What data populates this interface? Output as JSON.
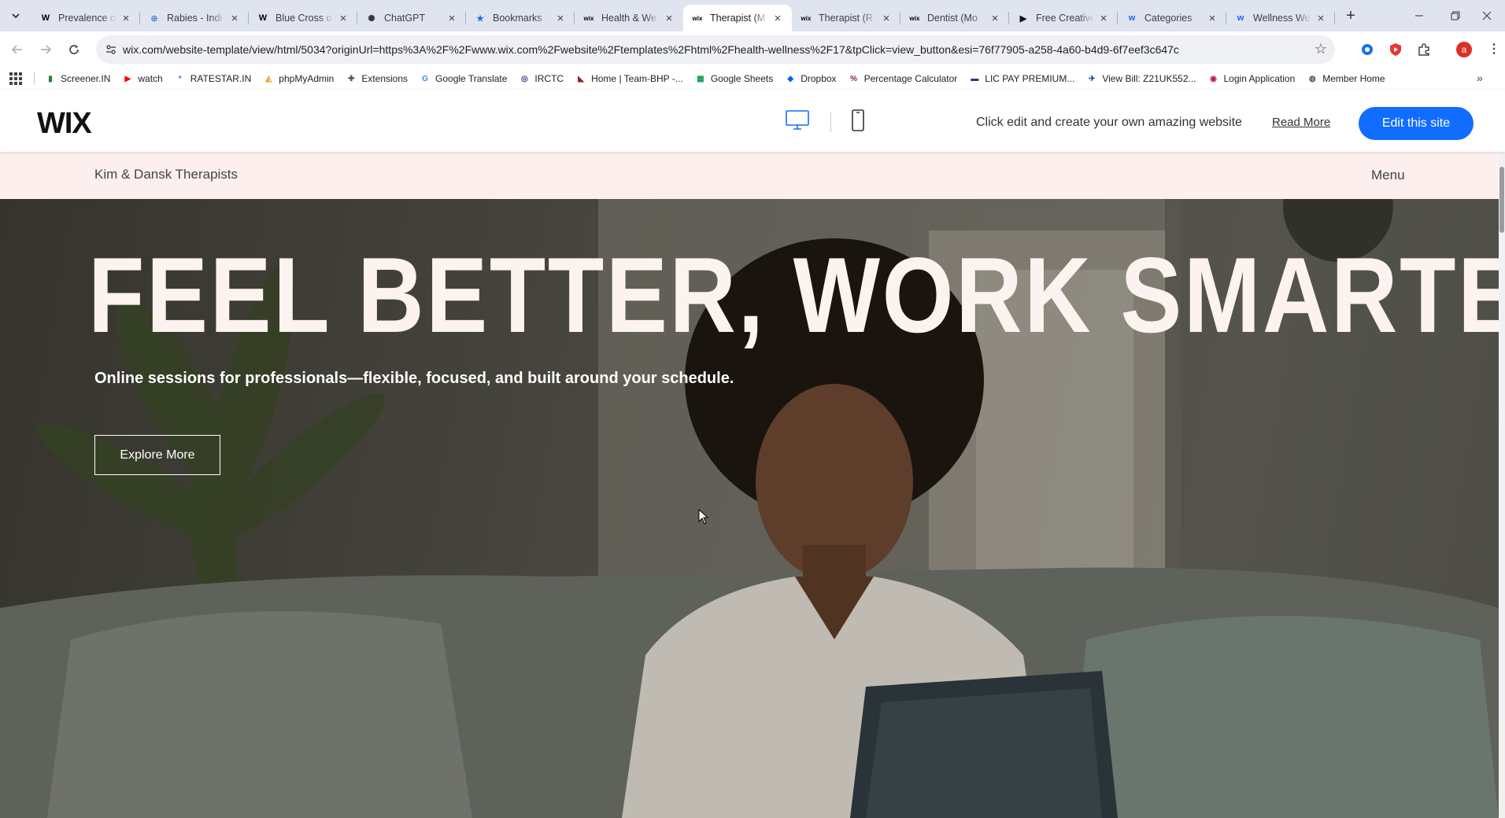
{
  "browser": {
    "tabs": [
      {
        "title": "Prevalence o",
        "favicon": "wikipedia-icon",
        "fav_text": "W",
        "fav_color": "#000000"
      },
      {
        "title": "Rabies - Indi",
        "favicon": "globe-icon",
        "fav_text": "⊕",
        "fav_color": "#5b8bd6"
      },
      {
        "title": "Blue Cross o",
        "favicon": "wikipedia-icon",
        "fav_text": "W",
        "fav_color": "#000000"
      },
      {
        "title": "ChatGPT",
        "favicon": "chatgpt-icon",
        "fav_text": "✺",
        "fav_color": "#333333"
      },
      {
        "title": "Bookmarks",
        "favicon": "star-icon",
        "fav_text": "★",
        "fav_color": "#1a73e8"
      },
      {
        "title": "Health & We",
        "favicon": "wix-icon",
        "fav_text": "wix",
        "fav_color": "#000000"
      },
      {
        "title": "Therapist (M",
        "favicon": "wix-icon",
        "fav_text": "wix",
        "fav_color": "#000000"
      },
      {
        "title": "Therapist (R",
        "favicon": "wix-icon",
        "fav_text": "wix",
        "fav_color": "#000000"
      },
      {
        "title": "Dentist (Mo",
        "favicon": "wix-icon",
        "fav_text": "wix",
        "fav_color": "#000000"
      },
      {
        "title": "Free Creative",
        "favicon": "framer-icon",
        "fav_text": "▶",
        "fav_color": "#111111"
      },
      {
        "title": "Categories",
        "favicon": "webflow-icon",
        "fav_text": "w",
        "fav_color": "#1a66ff"
      },
      {
        "title": "Wellness We",
        "favicon": "webflow-icon",
        "fav_text": "w",
        "fav_color": "#1a66ff"
      }
    ],
    "active_tab_index": 6,
    "url": "wix.com/website-template/view/html/5034?originUrl=https%3A%2F%2Fwww.wix.com%2Fwebsite%2Ftemplates%2Fhtml%2Fhealth-wellness%2F17&tpClick=view_button&esi=76f77905-a258-4a60-b4d9-6f7eef3c647c",
    "profile_initial": "a",
    "bookmarks": [
      {
        "label": "Screener.IN",
        "icon": "bar-chart-icon",
        "text": "▮",
        "color": "#2e7d32"
      },
      {
        "label": "watch",
        "icon": "youtube-icon",
        "text": "▶",
        "color": "#ff0000"
      },
      {
        "label": "RATESTAR.IN",
        "icon": "ratestar-icon",
        "text": "⁺",
        "color": "#1a73e8"
      },
      {
        "label": "phpMyAdmin",
        "icon": "phpmyadmin-icon",
        "text": "◭",
        "color": "#f29111"
      },
      {
        "label": "Extensions",
        "icon": "puzzle-icon",
        "text": "✚",
        "color": "#555555"
      },
      {
        "label": "Google Translate",
        "icon": "translate-icon",
        "text": "G",
        "color": "#4285f4"
      },
      {
        "label": "IRCTC",
        "icon": "irctc-icon",
        "text": "◎",
        "color": "#2b3f8c"
      },
      {
        "label": "Home | Team-BHP -...",
        "icon": "teambhp-icon",
        "text": "◣",
        "color": "#9b1b1b"
      },
      {
        "label": "Google Sheets",
        "icon": "sheets-icon",
        "text": "▦",
        "color": "#0f9d58"
      },
      {
        "label": "Dropbox",
        "icon": "dropbox-icon",
        "text": "◆",
        "color": "#0061fe"
      },
      {
        "label": "Percentage Calculator",
        "icon": "percent-icon",
        "text": "%",
        "color": "#7a1f2b"
      },
      {
        "label": "LIC PAY PREMIUM...",
        "icon": "lic-icon",
        "text": "▬",
        "color": "#1a3d8f"
      },
      {
        "label": "View Bill: Z21UK552...",
        "icon": "bill-icon",
        "text": "✈",
        "color": "#1a3d8f"
      },
      {
        "label": "Login Application",
        "icon": "login-icon",
        "text": "◉",
        "color": "#c2185b"
      },
      {
        "label": "Member Home",
        "icon": "globe-icon",
        "text": "◍",
        "color": "#555555"
      }
    ]
  },
  "wix_bar": {
    "logo": "WIX",
    "message": "Click edit and create your own amazing website",
    "read_more": "Read More",
    "edit_button": "Edit this site",
    "accent": "#116dff"
  },
  "site": {
    "name": "Kim & Dansk Therapists",
    "menu": "Menu",
    "header_bg": "#fcefee",
    "hero": {
      "title": "FEEL BETTER, WORK SMARTER",
      "subtitle": "Online sessions for professionals—flexible, focused, and built around your schedule.",
      "cta": "Explore More"
    }
  }
}
